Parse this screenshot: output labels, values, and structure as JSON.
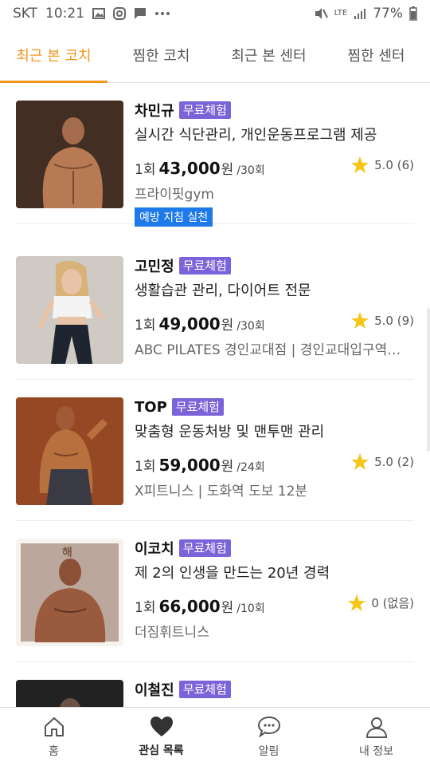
{
  "status_bar": {
    "carrier": "SKT",
    "time": "10:21",
    "network": "LTE",
    "battery": "77%"
  },
  "tabs": [
    {
      "label": "최근 본 코치",
      "active": true
    },
    {
      "label": "찜한 코치",
      "active": false
    },
    {
      "label": "최근 본 센터",
      "active": false
    },
    {
      "label": "찜한 센터",
      "active": false
    }
  ],
  "coaches": [
    {
      "name": "차민규",
      "badge": "무료체험",
      "description": "실시간 식단관리, 개인운동프로그램 제공",
      "price_prefix": "1회",
      "price": "43,000",
      "price_unit": "원",
      "per_sessions": "/30회",
      "rating": "5.0 (6)",
      "location": "프라이핏gym",
      "tag": "예방 지침 실천"
    },
    {
      "name": "고민정",
      "badge": "무료체험",
      "description": "생활습관 관리, 다이어트 전문",
      "price_prefix": "1회",
      "price": "49,000",
      "price_unit": "원",
      "per_sessions": "/30회",
      "rating": "5.0 (9)",
      "location": "ABC PILATES 경인교대점 | 경인교대입구역…"
    },
    {
      "name": "TOP",
      "badge": "무료체험",
      "description": "맞춤형 운동처방 및 맨투맨 관리",
      "price_prefix": "1회",
      "price": "59,000",
      "price_unit": "원",
      "per_sessions": "/24회",
      "rating": "5.0 (2)",
      "location": "X피트니스 | 도화역 도보 12분"
    },
    {
      "name": "이코치",
      "badge": "무료체험",
      "description": "제 2의 인생을 만드는 20년 경력",
      "price_prefix": "1회",
      "price": "66,000",
      "price_unit": "원",
      "per_sessions": "/10회",
      "rating": "0 (없음)",
      "location": "더짐휘트니스"
    },
    {
      "name": "이철진",
      "badge": "무료체험"
    }
  ],
  "bottom_nav": [
    {
      "label": "홈",
      "icon": "home-icon"
    },
    {
      "label": "관심 목록",
      "icon": "heart-icon",
      "active": true
    },
    {
      "label": "알림",
      "icon": "chat-bubble-icon"
    },
    {
      "label": "내 정보",
      "icon": "person-icon"
    }
  ],
  "colors": {
    "accent": "#f0961e",
    "badge": "#7b63d9",
    "tag": "#1e7ae8",
    "star": "#f5c518"
  }
}
